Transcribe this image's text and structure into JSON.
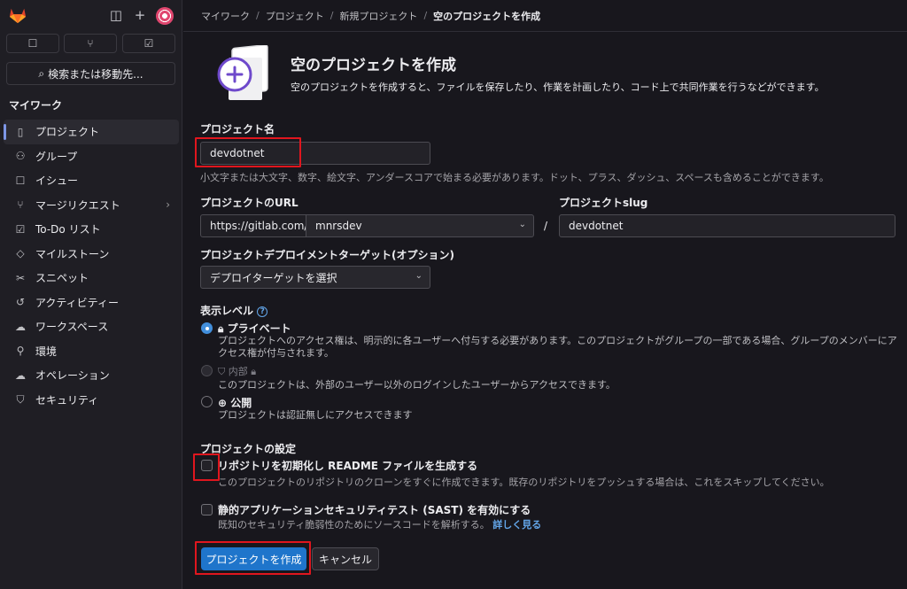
{
  "breadcrumb": [
    "マイワーク",
    "プロジェクト",
    "新規プロジェクト",
    "空のプロジェクトを作成"
  ],
  "sidebar": {
    "search_label": "検索または移動先...",
    "section_title": "マイワーク",
    "items": [
      {
        "label": "プロジェクト",
        "icon": "project-icon",
        "glyph": "▯",
        "active": true
      },
      {
        "label": "グループ",
        "icon": "group-icon",
        "glyph": "⚇"
      },
      {
        "label": "イシュー",
        "icon": "issue-icon",
        "glyph": "☐"
      },
      {
        "label": "マージリクエスト",
        "icon": "merge-request-icon",
        "glyph": "⑂",
        "chevron": true
      },
      {
        "label": "To-Do リスト",
        "icon": "todo-icon",
        "glyph": "☑"
      },
      {
        "label": "マイルストーン",
        "icon": "milestone-icon",
        "glyph": "◇"
      },
      {
        "label": "スニペット",
        "icon": "snippet-icon",
        "glyph": "✂"
      },
      {
        "label": "アクティビティー",
        "icon": "activity-icon",
        "glyph": "↺"
      },
      {
        "label": "ワークスペース",
        "icon": "workspace-icon",
        "glyph": "☁"
      },
      {
        "label": "環境",
        "icon": "environment-icon",
        "glyph": "⚲"
      },
      {
        "label": "オペレーション",
        "icon": "operations-icon",
        "glyph": "☁"
      },
      {
        "label": "セキュリティ",
        "icon": "security-icon",
        "glyph": "⛉"
      }
    ]
  },
  "header": {
    "title": "空のプロジェクトを作成",
    "description": "空のプロジェクトを作成すると、ファイルを保存したり、作業を計画したり、コード上で共同作業を行うなどができます。"
  },
  "form": {
    "project_name_label": "プロジェクト名",
    "project_name_value": "devdotnet",
    "project_name_help": "小文字または大文字、数字、絵文字、アンダースコアで始まる必要があります。ドット、プラス、ダッシュ、スペースも含めることができます。",
    "url_label": "プロジェクトのURL",
    "url_prefix": "https://gitlab.com/",
    "namespace_value": "mnrsdev",
    "slash": "/",
    "slug_label": "プロジェクトslug",
    "slug_value": "devdotnet",
    "deploy_label": "プロジェクトデプロイメントターゲット(オプション)",
    "deploy_value": "デプロイターゲットを選択",
    "visibility_label": "表示レベル",
    "visibility": [
      {
        "title": "プライベート",
        "icon": "lock-icon",
        "desc": "プロジェクトへのアクセス権は、明示的に各ユーザーへ付与する必要があります。このプロジェクトがグループの一部である場合、グループのメンバーにアクセス権が付与されます。",
        "selected": true
      },
      {
        "title": "内部",
        "icon": "shield-icon",
        "desc": "このプロジェクトは、外部のユーザー以外のログインしたユーザーからアクセスできます。",
        "disabled": true
      },
      {
        "title": "公開",
        "icon": "globe-icon",
        "desc": "プロジェクトは認証無しにアクセスできます"
      }
    ],
    "settings_label": "プロジェクトの設定",
    "readme_title": "リポジトリを初期化し README ファイルを生成する",
    "readme_desc": "このプロジェクトのリポジトリのクローンをすぐに作成できます。既存のリポジトリをプッシュする場合は、これをスキップしてください。",
    "sast_title": "静的アプリケーションセキュリティテスト (SAST) を有効にする",
    "sast_desc": "既知のセキュリティ脆弱性のためにソースコードを解析する。",
    "sast_link": "詳しく見る",
    "create_button": "プロジェクトを作成",
    "cancel_button": "キャンセル"
  }
}
